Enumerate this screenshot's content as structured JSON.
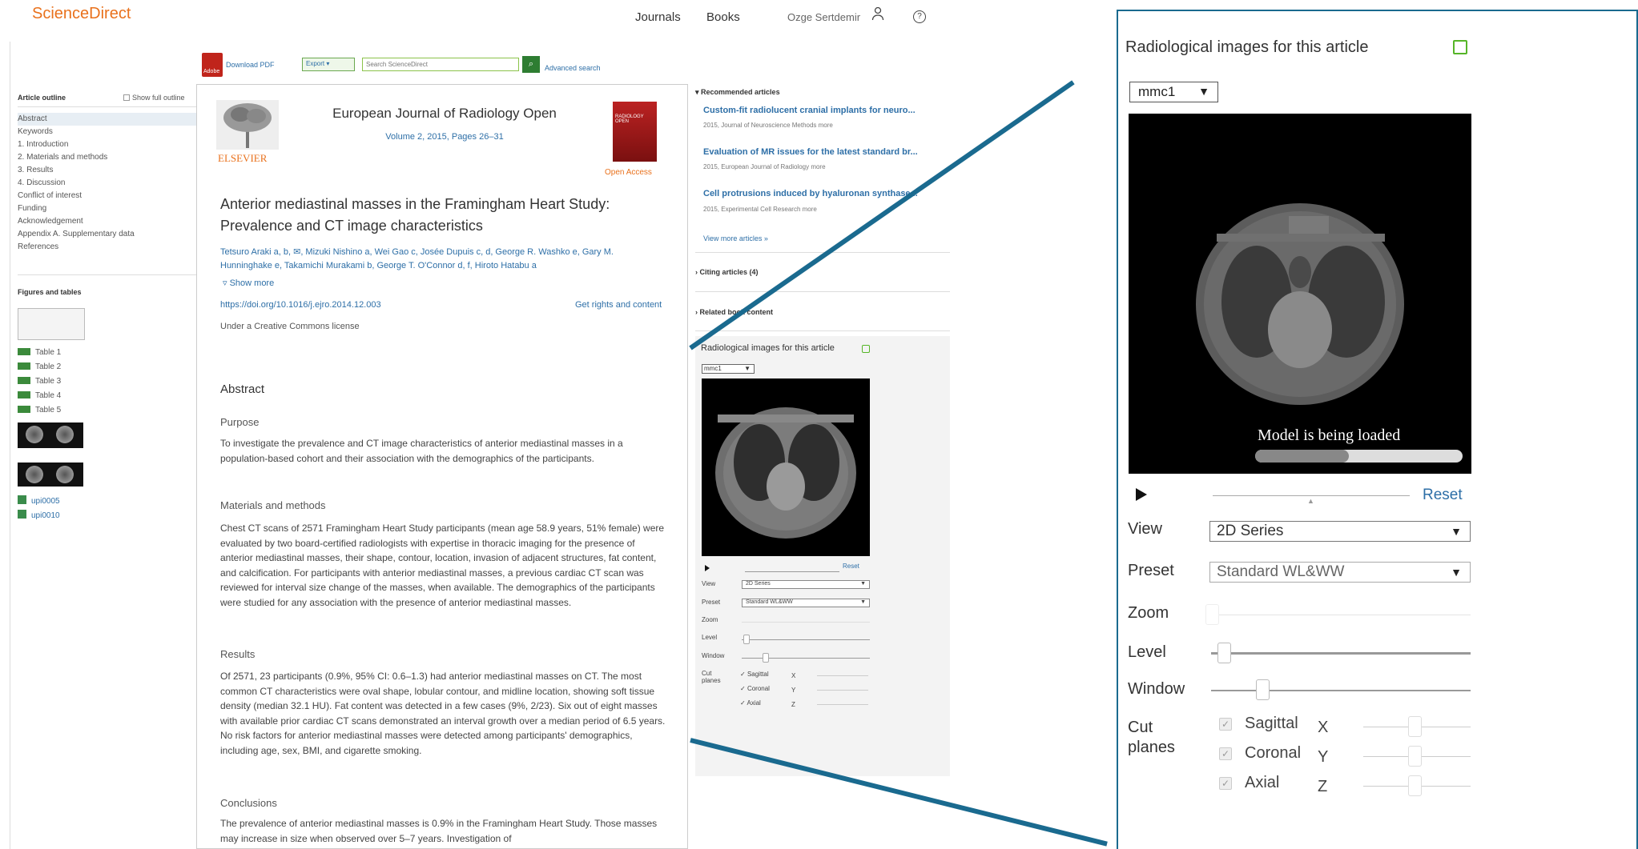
{
  "header": {
    "brand": "ScienceDirect",
    "nav": [
      "Journals",
      "Books"
    ],
    "user_name": "Ozge Sertdemir",
    "user_icon": "user-icon",
    "help_icon": "help-icon"
  },
  "toolbar": {
    "download_pdf": "Download PDF",
    "pdf_badge": "Adobe",
    "export_label": "Export",
    "search_placeholder": "Search ScienceDirect",
    "advanced_search": "Advanced search"
  },
  "outline": {
    "title": "Article outline",
    "show_full": "Show full outline",
    "items": [
      "Abstract",
      "Keywords",
      "1. Introduction",
      "2. Materials and methods",
      "3. Results",
      "4. Discussion",
      "Conflict of interest",
      "Funding",
      "Acknowledgement",
      "Appendix A. Supplementary data",
      "References"
    ],
    "figures_title": "Figures and tables",
    "tables": [
      "Table 1",
      "Table 2",
      "Table 3",
      "Table 4",
      "Table 5"
    ],
    "supplements": [
      "upi0005",
      "upi0010"
    ]
  },
  "article": {
    "publisher": "ELSEVIER",
    "journal": "European Journal of Radiology Open",
    "volume": "Volume 2, 2015, Pages 26–31",
    "open_access": "Open Access",
    "cover_text": "RADIOLOGY OPEN",
    "title": "Anterior mediastinal masses in the Framingham Heart Study: Prevalence and CT image characteristics",
    "authors_line1": "Tetsuro Araki a, b, ✉, Mizuki Nishino a, Wei Gao c, Josée Dupuis c, d, George R. Washko e, Gary M.",
    "authors_line2": "Hunninghake e, Takamichi Murakami b, George T. O'Connor d, f, Hiroto Hatabu a",
    "show_more": "Show more",
    "doi": "https://doi.org/10.1016/j.ejro.2014.12.003",
    "rights": "Get rights and content",
    "license": "Under a Creative Commons license",
    "abstract_heading": "Abstract",
    "purpose_heading": "Purpose",
    "purpose_text": "To investigate the prevalence and CT image characteristics of anterior mediastinal masses in a population-based cohort and their association with the demographics of the participants.",
    "methods_heading": "Materials and methods",
    "methods_text": "Chest CT scans of 2571 Framingham Heart Study participants (mean age 58.9 years, 51% female) were evaluated by two board-certified radiologists with expertise in thoracic imaging for the presence of anterior mediastinal masses, their shape, contour, location, invasion of adjacent structures, fat content, and calcification. For participants with anterior mediastinal masses, a previous cardiac CT scan was reviewed for interval size change of the masses, when available. The demographics of the participants were studied for any association with the presence of anterior mediastinal masses.",
    "results_heading": "Results",
    "results_text": "Of 2571, 23 participants (0.9%, 95% CI: 0.6–1.3) had anterior mediastinal masses on CT. The most common CT characteristics were oval shape, lobular contour, and midline location, showing soft tissue density (median 32.1 HU). Fat content was detected in a few cases (9%, 2/23). Six out of eight masses with available prior cardiac CT scans demonstrated an interval growth over a median period of 6.5 years. No risk factors for anterior mediastinal masses were detected among participants' demographics, including age, sex, BMI, and cigarette smoking.",
    "conclusions_heading": "Conclusions",
    "conclusions_text": "The prevalence of anterior mediastinal masses is 0.9% in the Framingham Heart Study. Those masses may increase in size when observed over 5–7 years. Investigation of"
  },
  "sidebar": {
    "recommended_heading": "Recommended articles",
    "recommended": [
      {
        "title": "Custom-fit radiolucent cranial implants for neuro...",
        "meta": "2015, Journal of Neuroscience Methods  more"
      },
      {
        "title": "Evaluation of MR issues for the latest standard br...",
        "meta": "2015, European Journal of Radiology  more"
      },
      {
        "title": "Cell protrusions induced by hyaluronan synthase...",
        "meta": "2015, Experimental Cell Research  more"
      }
    ],
    "view_more": "View more articles »",
    "citing": "Citing articles (4)",
    "related": "Related book content"
  },
  "viewer": {
    "title": "Radiological images for this article",
    "external_icon": "external-link-icon",
    "model_select": "mmc1",
    "loading_text": "Model is being loaded",
    "loading_progress": 0.45,
    "play_icon": "play-icon",
    "reset": "Reset",
    "view_label": "View",
    "view_value": "2D Series",
    "preset_label": "Preset",
    "preset_value": "Standard WL&WW",
    "zoom_label": "Zoom",
    "level_label": "Level",
    "window_label": "Window",
    "cut_label_1": "Cut",
    "cut_label_2": "planes",
    "cut_planes": [
      {
        "name": "Sagittal",
        "axis": "X",
        "checked": true
      },
      {
        "name": "Coronal",
        "axis": "Y",
        "checked": true
      },
      {
        "name": "Axial",
        "axis": "Z",
        "checked": true
      }
    ]
  },
  "colors": {
    "brand": "#e9711c",
    "link": "#2e6fa7",
    "callout": "#1a6a8f",
    "external_icon": "#56b528"
  }
}
